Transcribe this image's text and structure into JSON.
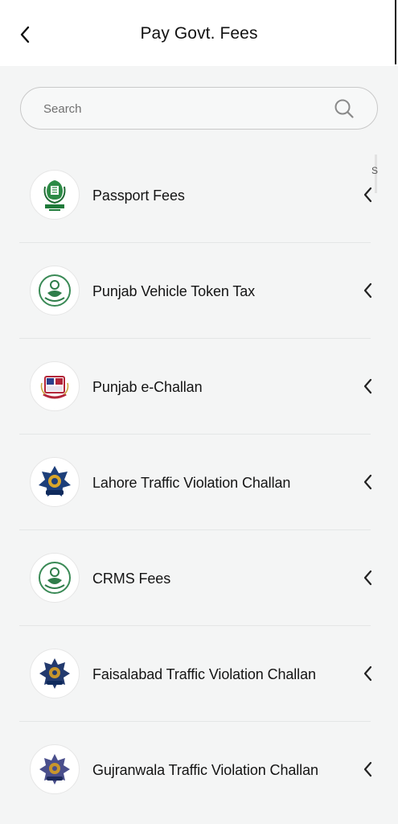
{
  "header": {
    "title": "Pay Govt. Fees",
    "back_icon": "chevron-left-icon"
  },
  "search": {
    "placeholder": "Search",
    "icon": "search-icon"
  },
  "scroll_hint": {
    "text": "S"
  },
  "list": {
    "items": [
      {
        "label": "Passport Fees",
        "logo": "nadra-logo"
      },
      {
        "label": "Punjab Vehicle Token Tax",
        "logo": "punjab-govt-logo"
      },
      {
        "label": "Punjab e-Challan",
        "logo": "punjab-safe-city-logo"
      },
      {
        "label": "Lahore Traffic Violation Challan",
        "logo": "lahore-traffic-police-logo"
      },
      {
        "label": "CRMS Fees",
        "logo": "punjab-govt-logo"
      },
      {
        "label": "Faisalabad Traffic Violation Challan",
        "logo": "faisalabad-traffic-police-logo"
      },
      {
        "label": "Gujranwala Traffic Violation Challan",
        "logo": "gujranwala-traffic-police-logo"
      }
    ],
    "chevron_icon": "chevron-left-icon"
  },
  "colors": {
    "background": "#f4f5f5",
    "header": "#ffffff",
    "nadra_green": "#1f7a3a",
    "punjab_green": "#2f7d4a",
    "police_blue": "#1d3f7a",
    "police_gold": "#d9a62a"
  }
}
